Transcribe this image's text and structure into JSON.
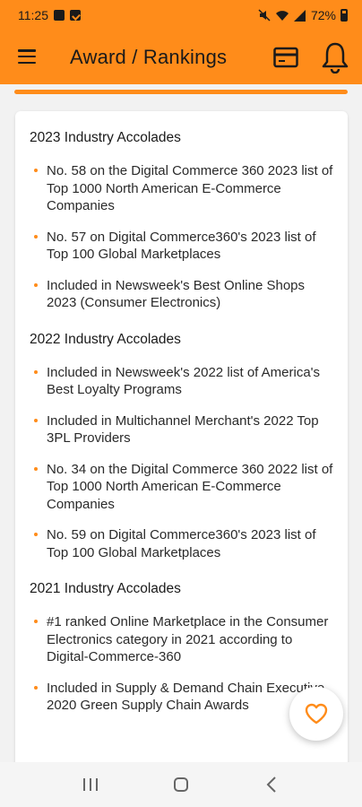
{
  "status_bar": {
    "time": "11:25",
    "battery": "72%"
  },
  "app_bar": {
    "title": "Award / Rankings",
    "icons": [
      "menu-icon",
      "card-icon",
      "bell-icon"
    ]
  },
  "colors": {
    "accent": "#ff8c1a",
    "background": "#f2f2f2",
    "card": "#ffffff"
  },
  "sections": [
    {
      "title": "2023 Industry Accolades",
      "items": [
        "No. 58 on the Digital Commerce 360 2023 list of Top 1000 North American E-Commerce Companies",
        "No. 57 on Digital Commerce360's 2023 list of Top 100 Global Marketplaces",
        "Included in Newsweek's Best Online Shops 2023 (Consumer Electronics)"
      ]
    },
    {
      "title": "2022 Industry Accolades",
      "items": [
        "Included in Newsweek's 2022 list of America's Best Loyalty Programs",
        "Included in Multichannel Merchant's 2022 Top 3PL Providers",
        "No. 34 on the Digital Commerce 360 2022 list of Top 1000 North American E-Commerce Companies",
        "No. 59 on Digital Commerce360's 2023 list of Top 100 Global Marketplaces"
      ]
    },
    {
      "title": "2021 Industry Accolades",
      "items": [
        "#1 ranked Online Marketplace in the Consumer Electronics category in 2021 according to Digital-Commerce-360",
        "Included in Supply & Demand Chain Executive 2020 Green Supply Chain Awards"
      ]
    }
  ],
  "fab": {
    "icon": "heart-icon"
  },
  "nav_bar": {
    "icons": [
      "recent-apps-icon",
      "home-icon",
      "back-icon"
    ]
  }
}
